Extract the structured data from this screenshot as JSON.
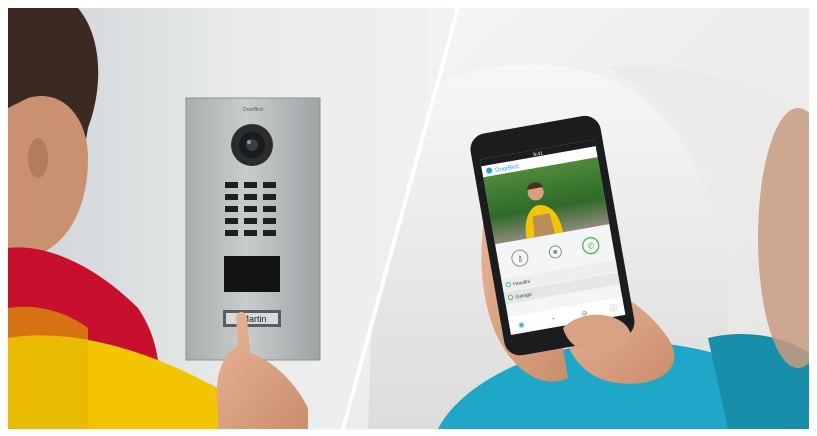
{
  "scene": {
    "doorbell_brand": "DoorBird",
    "nameplate": "Martin",
    "app": {
      "brand": "DoorBird",
      "status_time": "9:41",
      "list_items": [
        "Houdini",
        "Garage"
      ]
    }
  },
  "colors": {
    "wall": "#e7e9ea",
    "panel_steel": "#b9bcbd",
    "jacket_red": "#c8102e",
    "jacket_yellow": "#f2c500",
    "sofa_white": "#f3f3f1",
    "shirt_teal": "#1ea7c6",
    "app_accent": "#2a9fd6",
    "call_green": "#3cb54a"
  }
}
